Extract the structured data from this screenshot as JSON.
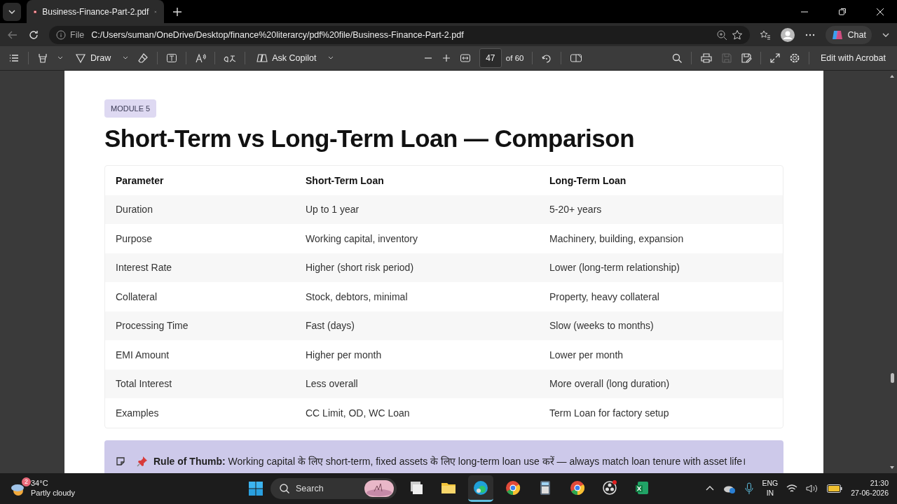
{
  "browser": {
    "tab": {
      "title": "Business-Finance-Part-2.pdf",
      "selected": true
    },
    "address": {
      "scheme": "File",
      "url": "C:/Users/suman/OneDrive/Desktop/finance%20literarcy/pdf%20file/Business-Finance-Part-2.pdf"
    },
    "chat": "Chat"
  },
  "toolbar": {
    "draw": "Draw",
    "copilot": "Ask Copilot",
    "page": "47",
    "page_count": "of 60",
    "edit": "Edit with Acrobat"
  },
  "document": {
    "badge": "MODULE 5",
    "title": "Short-Term vs Long-Term Loan — Comparison",
    "table": {
      "columns": [
        "Parameter",
        "Short-Term Loan",
        "Long-Term Loan"
      ],
      "rows": [
        [
          "Duration",
          "Up to 1 year",
          "5-20+ years"
        ],
        [
          "Purpose",
          "Working capital, inventory",
          "Machinery, building, expansion"
        ],
        [
          "Interest Rate",
          "Higher (short risk period)",
          "Lower (long-term relationship)"
        ],
        [
          "Collateral",
          "Stock, debtors, minimal",
          "Property, heavy collateral"
        ],
        [
          "Processing Time",
          "Fast (days)",
          "Slow (weeks to months)"
        ],
        [
          "EMI Amount",
          "Higher per month",
          "Lower per month"
        ],
        [
          "Total Interest",
          "Less overall",
          "More overall (long duration)"
        ],
        [
          "Examples",
          "CC Limit, OD, WC Loan",
          "Term Loan for factory setup"
        ]
      ]
    },
    "note": "**Rule of Thumb:** Working capital के लिए short-term, fixed assets के लिए long-term loan use करें — always match loan tenure with asset life।"
  },
  "taskbar": {
    "temperature": "34°C",
    "condition": "Partly cloudy",
    "weather_badge": "2",
    "search": "Search",
    "apps": [
      {
        "kind": "files",
        "selected": false
      },
      {
        "kind": "explorer",
        "selected": false
      },
      {
        "kind": "edge",
        "selected": true
      },
      {
        "kind": "chrome",
        "selected": false
      },
      {
        "kind": "calculator",
        "selected": false
      },
      {
        "kind": "chrome",
        "selected": false
      },
      {
        "kind": "obs",
        "selected": false
      },
      {
        "kind": "excel",
        "selected": false
      }
    ],
    "language": "ENG",
    "region": "IN",
    "time": "21:30",
    "date": "27-06-2026"
  }
}
